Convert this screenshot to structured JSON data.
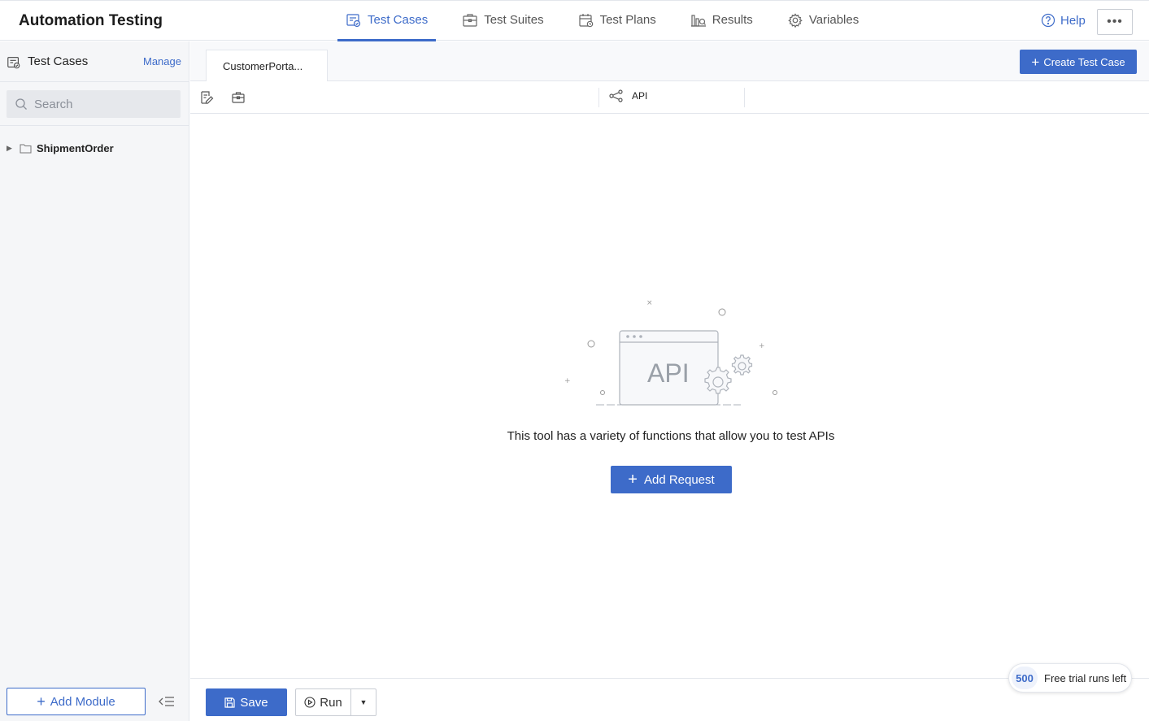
{
  "app": {
    "title": "Automation Testing"
  },
  "nav": {
    "tabs": [
      {
        "label": "Test Cases",
        "icon": "test-cases-icon",
        "active": true
      },
      {
        "label": "Test Suites",
        "icon": "test-suites-icon",
        "active": false
      },
      {
        "label": "Test Plans",
        "icon": "test-plans-icon",
        "active": false
      },
      {
        "label": "Results",
        "icon": "results-icon",
        "active": false
      },
      {
        "label": "Variables",
        "icon": "gear-icon",
        "active": false
      }
    ],
    "help_label": "Help",
    "more_label": "•••"
  },
  "sidebar": {
    "title": "Test Cases",
    "manage_label": "Manage",
    "search_placeholder": "Search",
    "tree": [
      {
        "label": "ShipmentOrder",
        "type": "folder",
        "expanded": false
      }
    ],
    "add_module_label": "Add Module"
  },
  "main": {
    "open_tab": "CustomerPorta...",
    "create_button": "Create Test Case",
    "api_tab": "API",
    "illustration_text": "API",
    "empty_message": "This tool has a variety of functions that allow you to test APIs",
    "add_request_label": "Add Request"
  },
  "footer": {
    "save_label": "Save",
    "run_label": "Run",
    "trial_count": "500",
    "trial_label": "Free trial runs left"
  },
  "colors": {
    "accent": "#3d6bc9",
    "sidebar_bg": "#f5f6f8",
    "border": "#e3e6ec"
  }
}
